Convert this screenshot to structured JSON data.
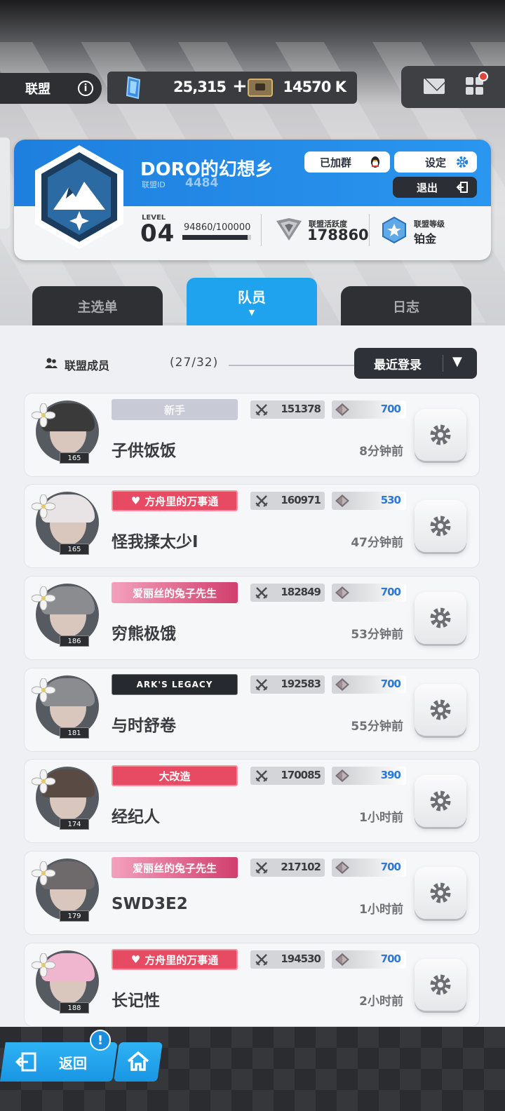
{
  "topbar": {
    "alliance_label": "联盟",
    "info_icon": "info-icon",
    "gems": "25,315",
    "plus": "+",
    "credits": "14570 K",
    "mail_icon": "mail-icon",
    "menu_icon": "grid-menu-icon"
  },
  "card": {
    "name": "DORO的幻想乡",
    "id_label": "联盟ID",
    "id_value": "4484",
    "joined_label": "已加群",
    "settings_label": "设定",
    "exit_label": "退出",
    "level_label": "LEVEL",
    "level_value": "04",
    "exp_text": "94860/100000",
    "exp_fraction": 0.9486,
    "activity_label": "联盟活跃度",
    "activity_value": "178860",
    "rank_label": "联盟等级",
    "rank_value": "铂金"
  },
  "tabs": {
    "main": "主选单",
    "members": "队员",
    "members_caret": "▼",
    "log": "日志"
  },
  "list_header": {
    "label": "联盟成员",
    "count": "(27/32)",
    "sort_label": "最近登录",
    "sort_arrow": "▼"
  },
  "members": [
    {
      "name": "子供饭饭",
      "level": "165",
      "title": "新手",
      "combat": "151378",
      "contrib": "700",
      "last_login": "8分钟前"
    },
    {
      "name": "怪我揉太少I",
      "level": "165",
      "title": "方舟里的万事通",
      "combat": "160971",
      "contrib": "530",
      "last_login": "47分钟前"
    },
    {
      "name": "穷熊极饿",
      "level": "186",
      "title": "爱丽丝的兔子先生",
      "combat": "182849",
      "contrib": "700",
      "last_login": "53分钟前"
    },
    {
      "name": "与时舒卷",
      "level": "181",
      "title": "ARK'S LEGACY",
      "combat": "192583",
      "contrib": "700",
      "last_login": "55分钟前"
    },
    {
      "name": "经纪人",
      "level": "174",
      "title": "大改造",
      "combat": "170085",
      "contrib": "390",
      "last_login": "1小时前"
    },
    {
      "name": "SWD3E2",
      "level": "179",
      "title": "爱丽丝的兔子先生",
      "combat": "217102",
      "contrib": "700",
      "last_login": "1小时前"
    },
    {
      "name": "长记性",
      "level": "188",
      "title": "方舟里的万事通",
      "combat": "194530",
      "contrib": "700",
      "last_login": "2小时前"
    }
  ],
  "bottom": {
    "back_label": "返回",
    "alert": "!",
    "home_icon": "home-icon"
  },
  "colors": {
    "accent_blue": "#1fa3ee",
    "dark": "#2e3034",
    "contrib_blue": "#2b79d9",
    "title_red": "#e64b63"
  }
}
